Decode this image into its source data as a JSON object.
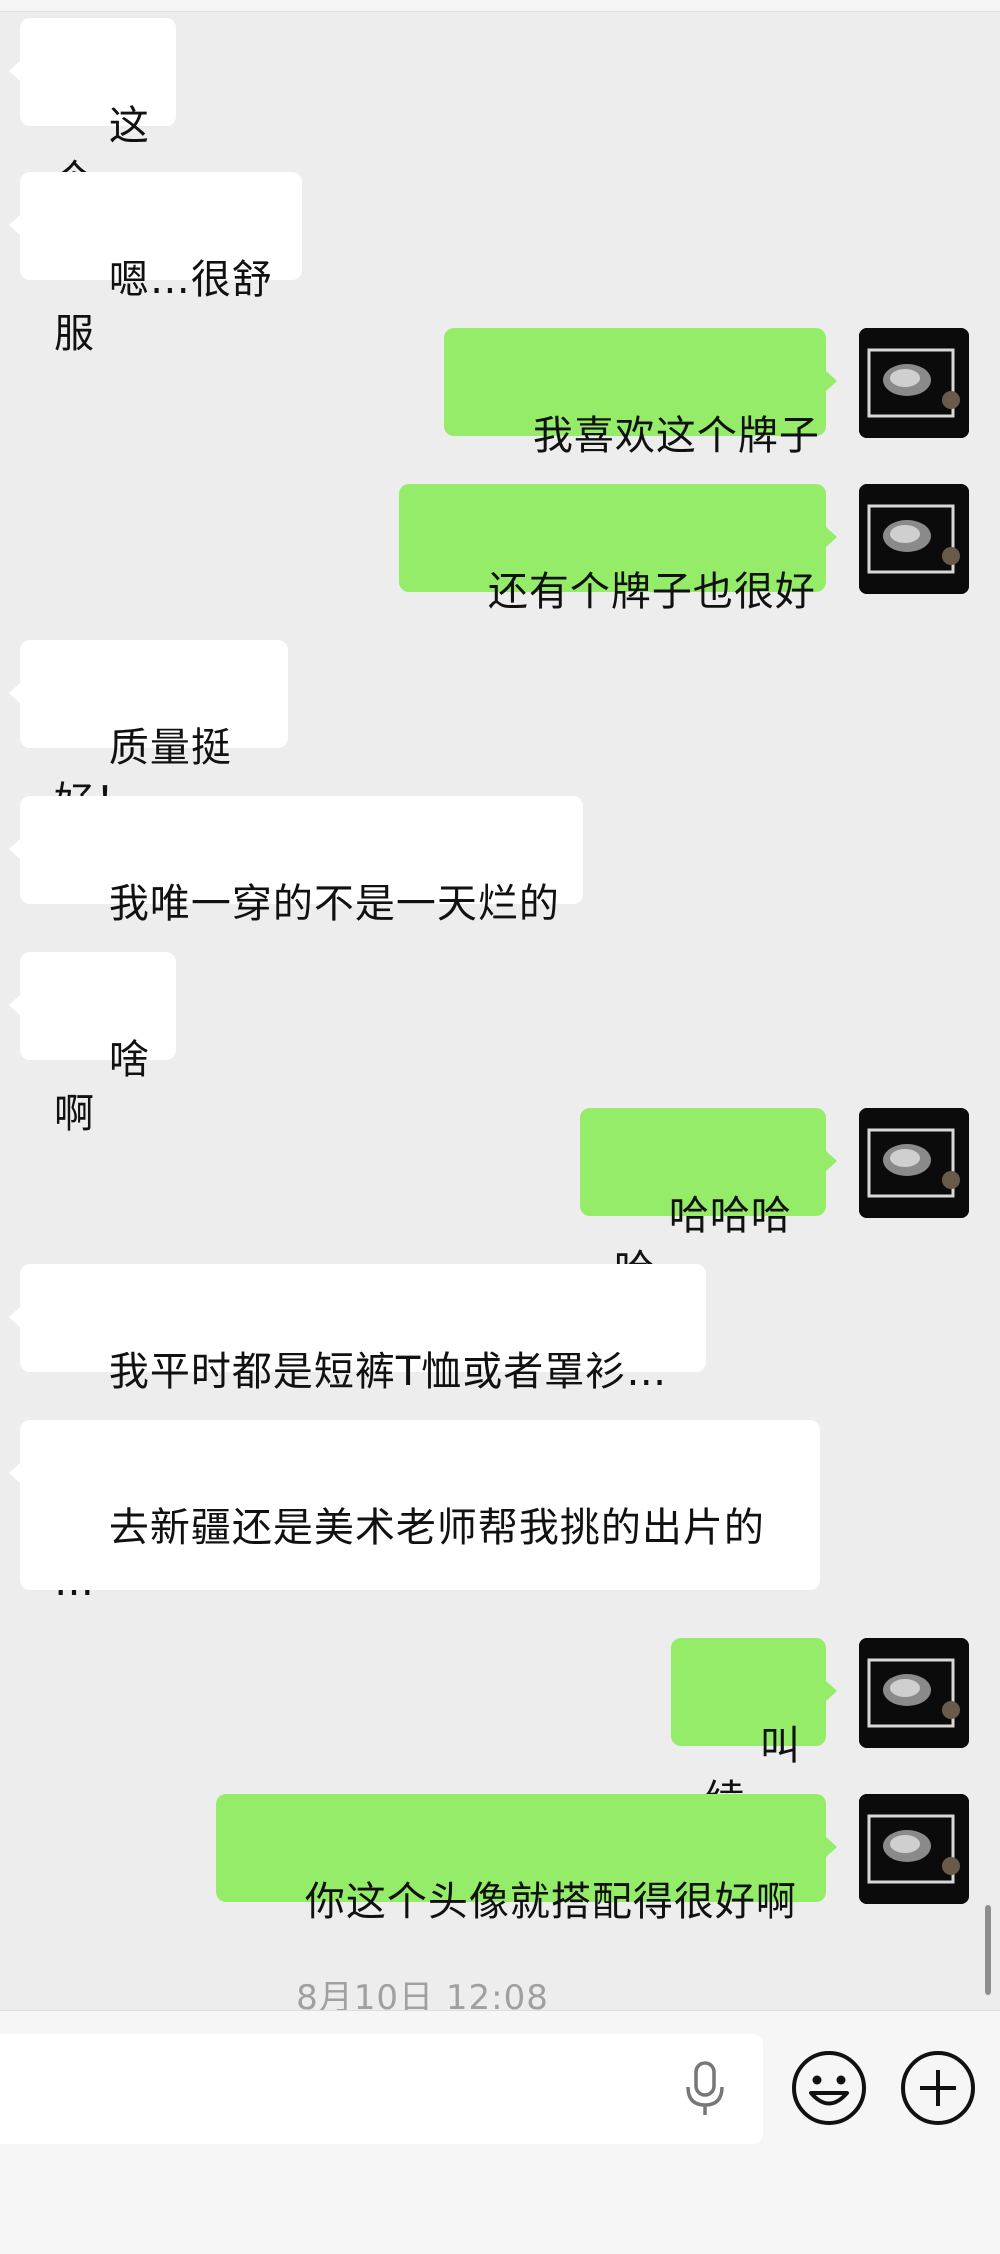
{
  "chat": {
    "messages": [
      {
        "side": "left",
        "text": "这个"
      },
      {
        "side": "left",
        "text": "嗯…很舒服"
      },
      {
        "side": "right",
        "text": "我喜欢这个牌子"
      },
      {
        "side": "right",
        "text": "还有个牌子也很好"
      },
      {
        "side": "left",
        "text": "质量挺好！"
      },
      {
        "side": "left",
        "text": "我唯一穿的不是一天烂的"
      },
      {
        "side": "left",
        "text": "啥啊"
      },
      {
        "side": "right",
        "text": "哈哈哈哈"
      },
      {
        "side": "left",
        "text": "我平时都是短裤T恤或者罩衫…"
      },
      {
        "side": "left",
        "text": "去新疆还是美术老师帮我挑的出片的\n…"
      },
      {
        "side": "right",
        "text": "叫绫"
      },
      {
        "side": "right",
        "text": "你这个头像就搭配得很好啊"
      }
    ],
    "timestamp": "8月10日 12:08"
  },
  "input_bar": {
    "text_value": "",
    "icons": [
      "microphone-icon",
      "emoji-icon",
      "plus-icon"
    ]
  },
  "colors": {
    "background": "#ededed",
    "incoming_bubble": "#ffffff",
    "outgoing_bubble": "#95ec69",
    "timestamp": "#a0a0a0"
  }
}
